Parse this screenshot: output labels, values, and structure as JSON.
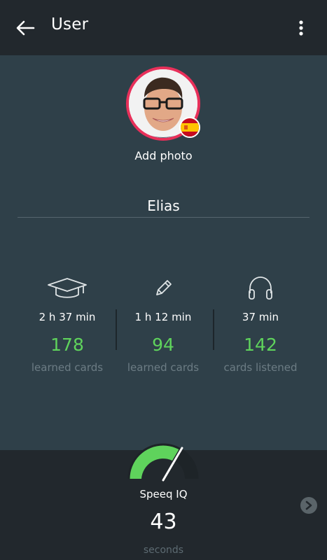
{
  "header": {
    "title": "User",
    "back_icon": "arrow-left-icon",
    "menu_icon": "more-vert-icon"
  },
  "profile": {
    "add_photo_label": "Add photo",
    "name": "Elias",
    "flag_icon": "spain-flag-icon",
    "ring_color": "#e8305a"
  },
  "stats": [
    {
      "icon": "graduation-cap-icon",
      "time": "2 h 37 min",
      "count": "178",
      "label": "learned cards"
    },
    {
      "icon": "pencil-icon",
      "time": "1 h 12 min",
      "count": "94",
      "label": "learned cards"
    },
    {
      "icon": "headphones-icon",
      "time": "37 min",
      "count": "142",
      "label": "cards listened"
    }
  ],
  "speeq": {
    "label": "Speeq IQ",
    "value": "43",
    "unit": "seconds",
    "gauge_icon": "speedometer-gauge-icon",
    "next_icon": "chevron-right-icon"
  },
  "colors": {
    "accent_green": "#5fd35c",
    "background": "#2f4049",
    "bar": "#22282d"
  }
}
